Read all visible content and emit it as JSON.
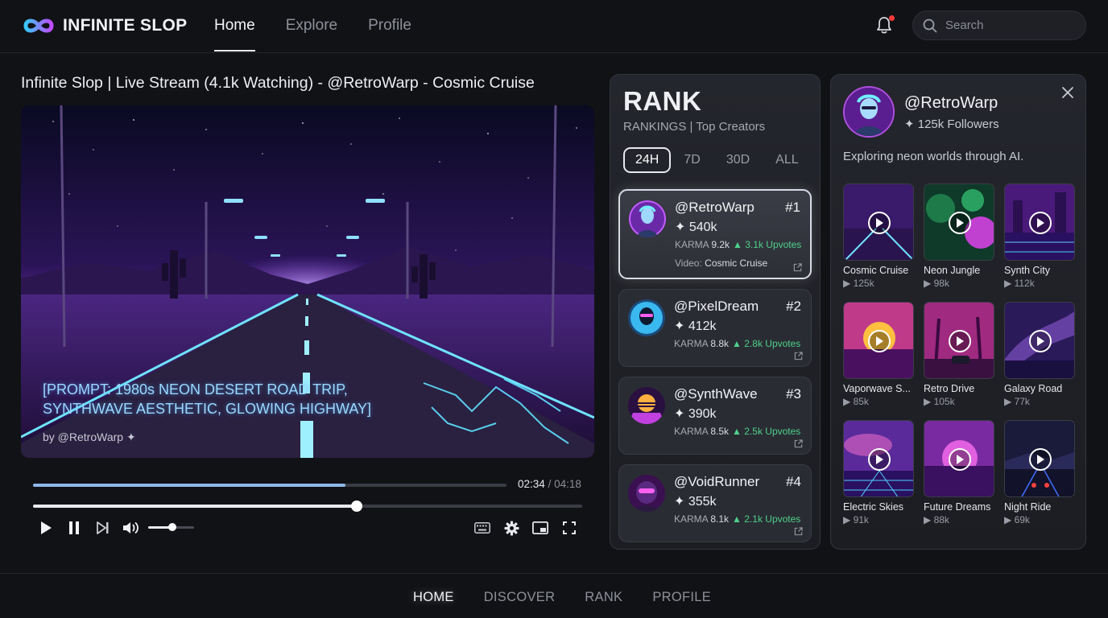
{
  "app": {
    "name": "INFINITE SLOP"
  },
  "nav": {
    "items": [
      "Home",
      "Explore",
      "Profile"
    ]
  },
  "search": {
    "placeholder": "Search"
  },
  "video": {
    "title": "Infinite Slop | Live Stream (4.1k Watching) - @RetroWarp - Cosmic Cruise",
    "prompt_line1": "[PROMPT: 1980s NEON DESERT ROAD TRIP,",
    "prompt_line2": "SYNTHWAVE AESTHETIC, GLOWING HIGHWAY]",
    "byline": "by @RetroWarp ✦",
    "current_time": "02:34",
    "separator": "/",
    "duration": "04:18",
    "buffer_progress": 0.66,
    "playback_progress": 0.589,
    "volume": 0.52
  },
  "rank": {
    "title": "RANK",
    "subtitle": "RANKINGS | Top Creators",
    "ranges": [
      "24H",
      "7D",
      "30D",
      "ALL"
    ],
    "active_range": "24H",
    "karma_label": "KARMA",
    "video_label": "Video:",
    "entries": [
      {
        "handle": "@RetroWarp",
        "position": "#1",
        "score": "✦ 540k",
        "karma": "9.2k",
        "upvotes": "▲ 3.1k Upvotes",
        "video": "Cosmic Cruise"
      },
      {
        "handle": "@PixelDream",
        "position": "#2",
        "score": "✦ 412k",
        "karma": "8.8k",
        "upvotes": "▲ 2.8k Upvotes"
      },
      {
        "handle": "@SynthWave",
        "position": "#3",
        "score": "✦ 390k",
        "karma": "8.5k",
        "upvotes": "▲ 2.5k Upvotes"
      },
      {
        "handle": "@VoidRunner",
        "position": "#4",
        "score": "✦ 355k",
        "karma": "8.1k",
        "upvotes": "▲ 2.1k Upvotes"
      }
    ]
  },
  "profile": {
    "handle": "@RetroWarp",
    "followers": "✦ 125k Followers",
    "bio": "Exploring neon worlds through AI.",
    "videos": [
      {
        "title": "Cosmic Cruise",
        "views": "▶ 125k"
      },
      {
        "title": "Neon Jungle",
        "views": "▶ 98k"
      },
      {
        "title": "Synth City",
        "views": "▶ 112k"
      },
      {
        "title": "Vaporwave S...",
        "views": "▶ 85k"
      },
      {
        "title": "Retro Drive",
        "views": "▶ 105k"
      },
      {
        "title": "Galaxy Road",
        "views": "▶ 77k"
      },
      {
        "title": "Electric Skies",
        "views": "▶ 91k"
      },
      {
        "title": "Future Dreams",
        "views": "▶ 88k"
      },
      {
        "title": "Night Ride",
        "views": "▶ 69k"
      }
    ]
  },
  "bottom_nav": {
    "items": [
      "HOME",
      "DISCOVER",
      "RANK",
      "PROFILE"
    ],
    "active": "HOME"
  },
  "icons": {
    "logo": "infinity-logo-icon",
    "bell": "bell-icon",
    "search": "search-icon",
    "play": "play-icon",
    "pause": "pause-icon",
    "next": "skip-next-icon",
    "volume": "volume-icon",
    "keyboard": "keyboard-icon",
    "settings": "gear-icon",
    "miniplayer": "miniplayer-icon",
    "fullscreen": "fullscreen-icon",
    "external": "external-link-icon",
    "close": "close-icon"
  },
  "colors": {
    "accent": "#4ed08b",
    "notification": "#ff3b3b",
    "logo_gradient_start": "#38c8ff",
    "logo_gradient_end": "#c04cff"
  }
}
